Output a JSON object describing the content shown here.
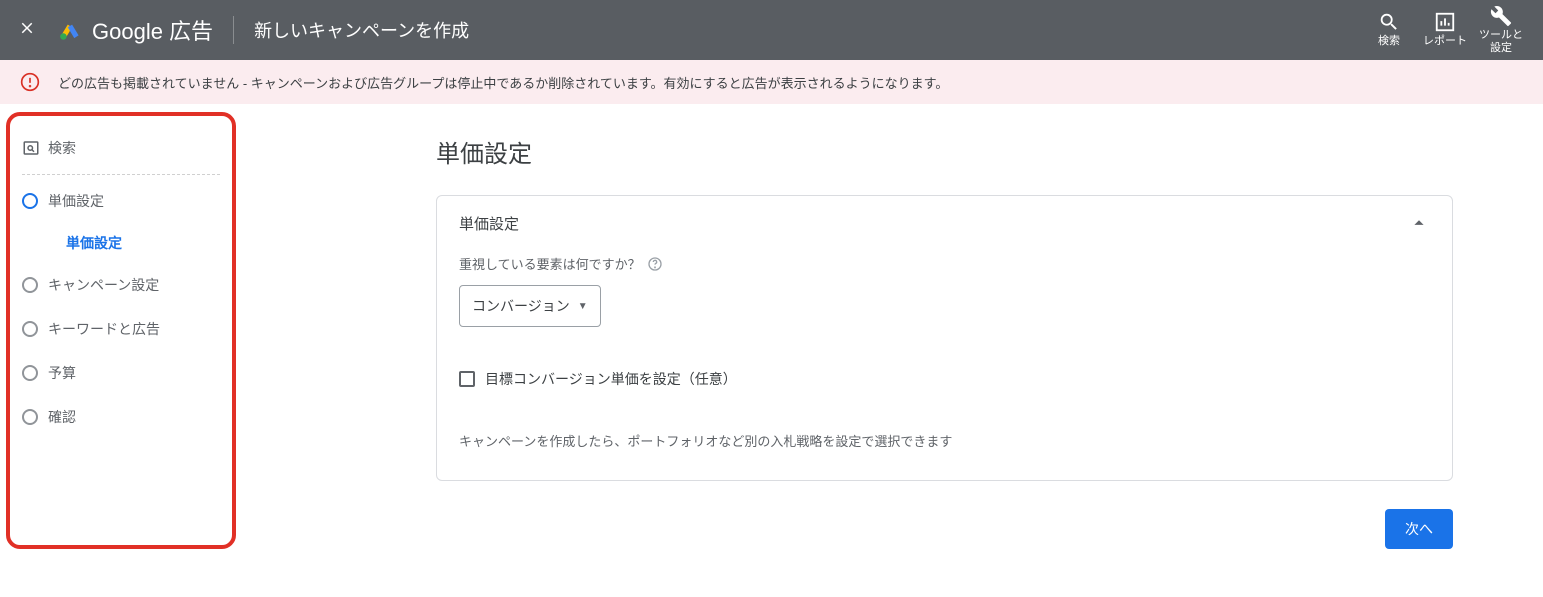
{
  "header": {
    "brand": "Google 広告",
    "title": "新しいキャンペーンを作成",
    "tools": {
      "search": "検索",
      "report": "レポート",
      "settings": "ツールと\n設定"
    }
  },
  "notice": {
    "text": "どの広告も掲載されていません - キャンペーンおよび広告グループは停止中であるか削除されています。有効にすると広告が表示されるようになります。"
  },
  "sidebar": {
    "top": "検索",
    "steps": {
      "bidding": "単価設定",
      "bidding_sub": "単価設定",
      "campaign": "キャンペーン設定",
      "keywords": "キーワードと広告",
      "budget": "予算",
      "confirm": "確認"
    }
  },
  "main": {
    "heading": "単価設定",
    "card_title": "単価設定",
    "focus_label": "重視している要素は何ですか？",
    "select_value": "コンバージョン",
    "checkbox_label": "目標コンバージョン単価を設定（任意）",
    "note": "キャンペーンを作成したら、ポートフォリオなど別の入札戦略を設定で選択できます",
    "next": "次へ"
  }
}
